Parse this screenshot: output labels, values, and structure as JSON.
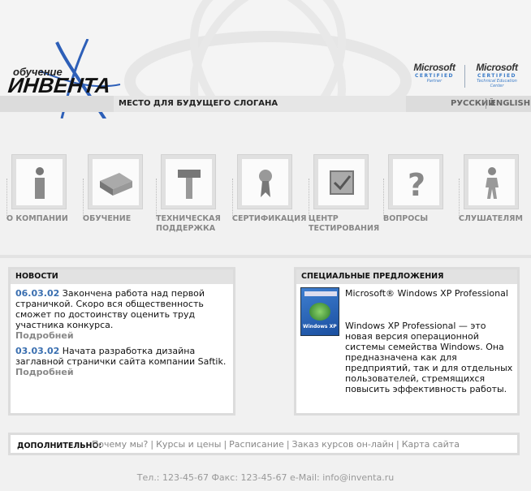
{
  "header": {
    "logo_small": "обучение",
    "logo_big": "ИНВЕНТА",
    "slogan": "МЕСТО ДЛЯ БУДУЩЕГО СЛОГАНА",
    "lang_ru": "РУССКИЙ",
    "lang_en": "ENGLISH",
    "ms1": {
      "brand": "Microsoft",
      "certified": "CERTIFIED",
      "sub": "Partner"
    },
    "ms2": {
      "brand": "Microsoft",
      "certified": "CERTIFIED",
      "sub": "Technical Education Center"
    }
  },
  "nav": [
    {
      "label": "О КОМПАНИИ",
      "icon": "info-icon"
    },
    {
      "label": "ОБУЧЕНИЕ",
      "icon": "books-icon"
    },
    {
      "label": "ТЕХНИЧЕСКАЯ ПОДДЕРЖКА",
      "icon": "hammer-icon"
    },
    {
      "label": "СЕРТИФИКАЦИЯ",
      "icon": "award-icon"
    },
    {
      "label": "ЦЕНТР ТЕСТИРОВАНИЯ",
      "icon": "checkbox-icon"
    },
    {
      "label": "ВОПРОСЫ",
      "icon": "question-icon"
    },
    {
      "label": "СЛУШАТЕЛЯМ",
      "icon": "person-icon"
    }
  ],
  "news": {
    "title": "НОВОСТИ",
    "items": [
      {
        "date": "06.03.02",
        "text": "Закончена работа над первой страничкой. Скоро вся общественность сможет по достоинству оценить труд участника конкурса.",
        "more": "Подробней"
      },
      {
        "date": "03.03.02",
        "text": "Начата разработка дизайна заглавной странички сайта компании Saftik.",
        "more": "Подробней"
      }
    ]
  },
  "offers": {
    "title": "СПЕЦИАЛЬНЫЕ ПРЕДЛОЖЕНИЯ",
    "product_title": "Microsoft® Windows XP Professional",
    "product_desc": "Windows XP Professional — это новая версия операционной системы семейства Windows. Она предназначена как для предприятий, так и для отдельных пользователей, стремящихся повысить эффективность работы.",
    "box_text": "Windows XP"
  },
  "additional": {
    "label": "ДОПОЛНИТЕЛЬНО:",
    "links": [
      "Почему мы?",
      "Курсы и цены",
      "Расписание",
      "Заказ курсов он-лайн",
      "Карта сайта"
    ],
    "sep": "|"
  },
  "footer": {
    "text": "Тел.: 123-45-67 Факс: 123-45-67 e-Mail: info@inventa.ru"
  }
}
